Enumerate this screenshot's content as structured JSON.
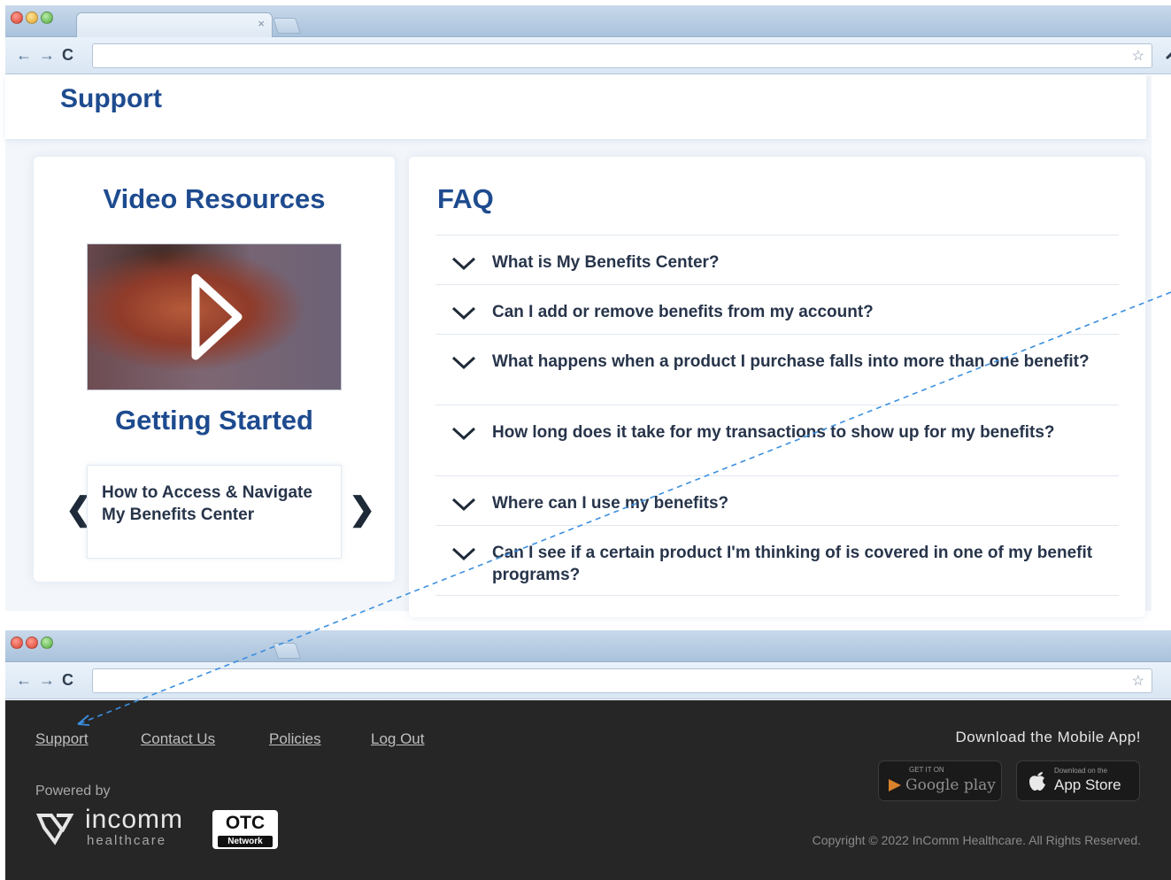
{
  "browser_top": {
    "tab_close": "×",
    "nav": {
      "back": "←",
      "forward": "→",
      "reload": "C"
    },
    "star": "☆"
  },
  "support": {
    "title": "Support"
  },
  "video_resources": {
    "title": "Video Resources",
    "icon": "play-icon",
    "getting_started": "Getting Started",
    "carousel_item": "How to Access & Navigate My Benefits Center",
    "prev": "❮",
    "next": "❯"
  },
  "faq": {
    "title": "FAQ",
    "items": [
      {
        "question": "What is My Benefits Center?"
      },
      {
        "question": "Can I add or remove benefits from my account?"
      },
      {
        "question": "What happens when a product I purchase falls into more than one benefit?"
      },
      {
        "question": "How long does it take for my transactions to show up for my benefits?"
      },
      {
        "question": "Where can I use my benefits?"
      },
      {
        "question": "Can I see if a certain product I'm thinking of is covered in one of my benefit programs?"
      }
    ]
  },
  "footer": {
    "links": {
      "support": "Support",
      "contact": "Contact Us",
      "policies": "Policies",
      "logout": "Log Out"
    },
    "powered_by": "Powered by",
    "incomm": "incomm",
    "healthcare": "healthcare",
    "otc": "OTC",
    "otc_network": "Network",
    "download_title": "Download the Mobile App!",
    "google": {
      "small": "GET IT ON",
      "big": "Google play"
    },
    "apple": {
      "small": "Download on the",
      "big": "App Store"
    },
    "copyright": "Copyright © 2022 InComm Healthcare. All Rights Reserved."
  },
  "colors": {
    "brand_blue": "#1e4b8f",
    "footer_bg": "#262626",
    "annotation": "#3b8fe0"
  }
}
